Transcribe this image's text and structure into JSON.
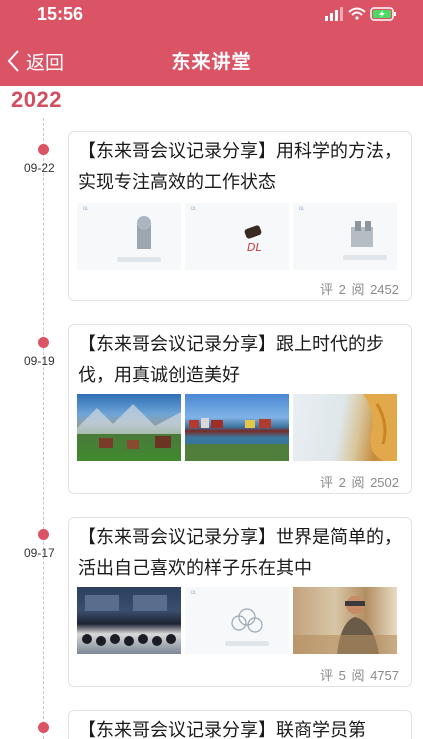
{
  "status_bar": {
    "time": "15:56"
  },
  "nav": {
    "back_label": "返回",
    "title": "东来讲堂"
  },
  "year": "2022",
  "articles": [
    {
      "date": "09-22",
      "title": "【东来哥会议记录分享】用科学的方法，实现专注高效的工作状态",
      "comments_label": "评",
      "comments": "2",
      "reads_label": "阅",
      "reads": "2452",
      "thumbs": [
        "slide-chess-piece",
        "slide-stamp",
        "slide-abacus"
      ]
    },
    {
      "date": "09-19",
      "title": "【东来哥会议记录分享】跟上时代的步伐，用真诚创造美好",
      "comments_label": "评",
      "comments": "2",
      "reads_label": "阅",
      "reads": "2502",
      "thumbs": [
        "mountain-village-photo",
        "lake-town-photo",
        "beach-photo"
      ]
    },
    {
      "date": "09-17",
      "title": "【东来哥会议记录分享】世界是简单的，活出自己喜欢的样子乐在其中",
      "comments_label": "评",
      "comments": "5",
      "reads_label": "阅",
      "reads": "4757",
      "thumbs": [
        "conference-photo",
        "slide-flower",
        "woodworker-photo"
      ]
    },
    {
      "date": "",
      "title": "【东来哥会议记录分享】联商学员第"
    }
  ],
  "colors": {
    "brand": "#db5466",
    "year": "#d14f60",
    "meta": "#8a8a8a"
  }
}
